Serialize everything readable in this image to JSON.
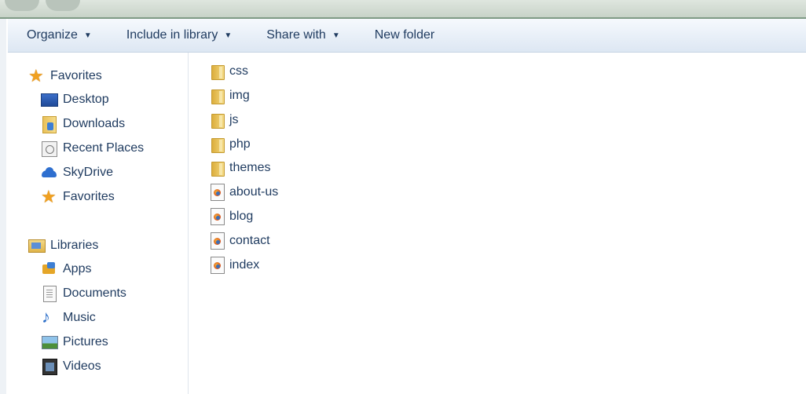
{
  "toolbar": {
    "organize": "Organize",
    "include_in_library": "Include in library",
    "share_with": "Share with",
    "new_folder": "New folder"
  },
  "nav": {
    "favorites_header": "Favorites",
    "favorites": [
      "Desktop",
      "Downloads",
      "Recent Places",
      "SkyDrive",
      "Favorites"
    ],
    "libraries_header": "Libraries",
    "libraries": [
      "Apps",
      "Documents",
      "Music",
      "Pictures",
      "Videos"
    ]
  },
  "files": [
    {
      "name": "css",
      "type": "folder"
    },
    {
      "name": "img",
      "type": "folder"
    },
    {
      "name": "js",
      "type": "folder"
    },
    {
      "name": "php",
      "type": "folder"
    },
    {
      "name": "themes",
      "type": "folder"
    },
    {
      "name": "about-us",
      "type": "html-file"
    },
    {
      "name": "blog",
      "type": "html-file"
    },
    {
      "name": "contact",
      "type": "html-file"
    },
    {
      "name": "index",
      "type": "html-file"
    }
  ],
  "icons": {
    "folder": "folder-icon",
    "html-file": "html-file-icon"
  },
  "colors": {
    "toolbar_gradient_top": "#f6f9fd",
    "toolbar_gradient_bottom": "#dde7f3",
    "text": "#1e3a5f"
  }
}
